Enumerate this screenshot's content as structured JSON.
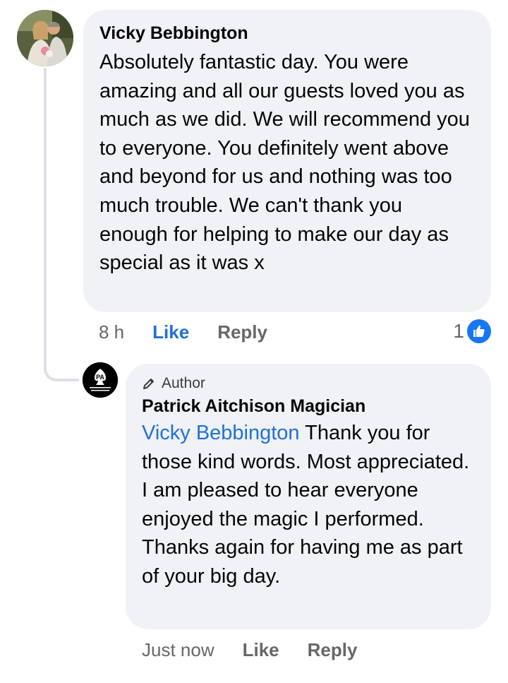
{
  "comment": {
    "author": "Vicky Bebbington",
    "text": "Absolutely fantastic day. You were amazing and all our guests loved you as much as we did. We will recommend you to everyone. You definitely went above and beyond for us and nothing was too much trouble. We can't thank you enough for helping to make our day as special as it was x",
    "time": "8 h",
    "like_label": "Like",
    "reply_label": "Reply",
    "reaction_count": "1",
    "reaction_icon": "thumbs-up-icon",
    "like_color": "#216fdb",
    "reaction_color": "#1877f2"
  },
  "reply": {
    "badge_label": "Author",
    "badge_icon": "pencil-icon",
    "author": "Patrick Aitchison Magician",
    "mention": "Vicky Bebbington",
    "text": "Thank you for those kind words. Most appreciated. I am pleased to hear everyone enjoyed the magic I performed. Thanks again for having me as part of your big day.",
    "time": "Just now",
    "like_label": "Like",
    "reply_label": "Reply"
  }
}
